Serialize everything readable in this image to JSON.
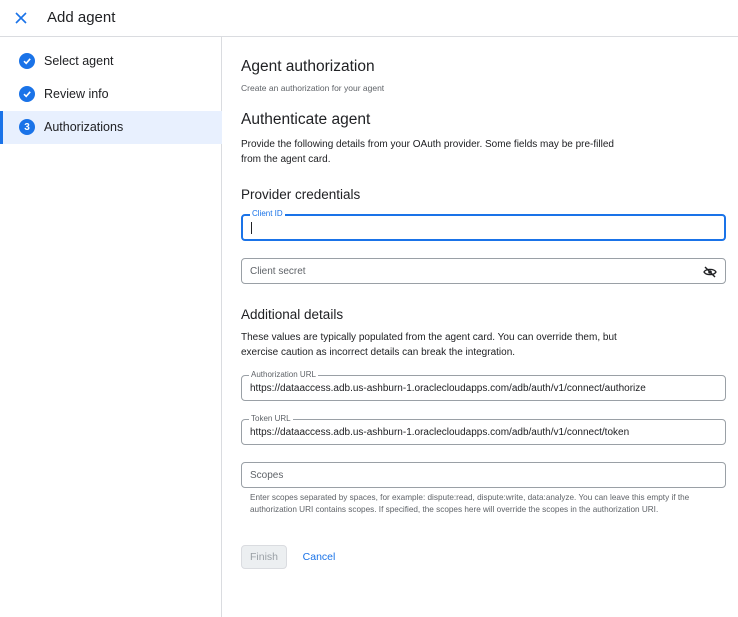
{
  "header": {
    "title": "Add agent",
    "close_icon": "close-icon"
  },
  "sidebar": {
    "steps": [
      {
        "label": "Select agent",
        "status": "complete",
        "icon": "check-circle-icon"
      },
      {
        "label": "Review info",
        "status": "complete",
        "icon": "check-circle-icon"
      },
      {
        "label": "Authorizations",
        "status": "current",
        "number": "3"
      }
    ]
  },
  "main": {
    "title": "Agent authorization",
    "subtitle": "Create an authorization for your agent",
    "authenticate": {
      "heading": "Authenticate agent",
      "description": "Provide the following details from your OAuth provider. Some fields may be pre-filled from the agent card."
    },
    "provider_credentials": {
      "heading": "Provider credentials",
      "client_id": {
        "label": "Client ID",
        "value": ""
      },
      "client_secret": {
        "placeholder": "Client secret",
        "toggle_icon": "visibility-off-icon"
      }
    },
    "additional_details": {
      "heading": "Additional details",
      "description": "These values are typically populated from the agent card. You can override them, but exercise caution as incorrect details can break the integration.",
      "authorization_url": {
        "label": "Authorization URL",
        "value": "https://dataaccess.adb.us-ashburn-1.oraclecloudapps.com/adb/auth/v1/connect/authorize"
      },
      "token_url": {
        "label": "Token URL",
        "value": "https://dataaccess.adb.us-ashburn-1.oraclecloudapps.com/adb/auth/v1/connect/token"
      },
      "scopes": {
        "placeholder": "Scopes",
        "helper": "Enter scopes separated by spaces, for example: dispute:read, dispute:write, data:analyze. You can leave this empty if the authorization URI contains scopes. If specified, the scopes here will override the scopes in the authorization URI."
      }
    },
    "actions": {
      "finish_label": "Finish",
      "finish_disabled": true,
      "cancel_label": "Cancel"
    }
  },
  "colors": {
    "accent": "#1a73e8",
    "active_step_bg": "#e8f0fe",
    "border": "#dadce0",
    "disabled_bg": "#eceff1"
  }
}
